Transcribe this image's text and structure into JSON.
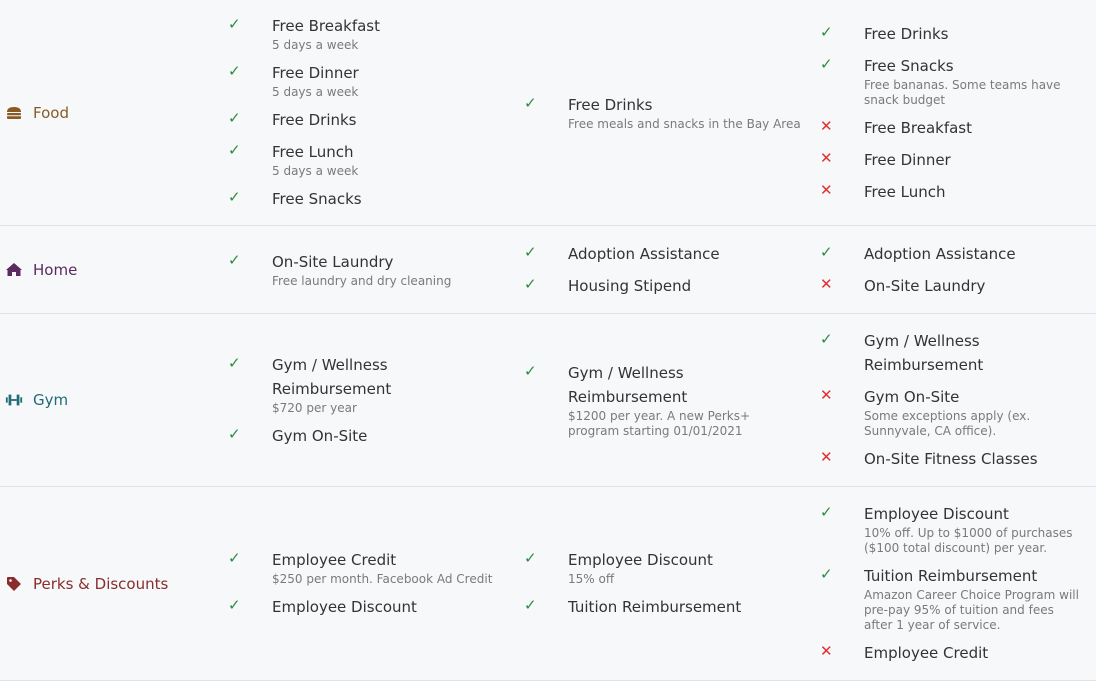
{
  "rows": [
    {
      "category": "Food",
      "icon": "burger-icon",
      "color": "#8a5a24",
      "cols": [
        [
          {
            "ok": true,
            "name": "Free Breakfast",
            "note": "5 days a week"
          },
          {
            "ok": true,
            "name": "Free Dinner",
            "note": "5 days a week"
          },
          {
            "ok": true,
            "name": "Free Drinks",
            "note": ""
          },
          {
            "ok": true,
            "name": "Free Lunch",
            "note": "5 days a week"
          },
          {
            "ok": true,
            "name": "Free Snacks",
            "note": ""
          }
        ],
        [
          {
            "ok": true,
            "name": "Free Drinks",
            "note": "Free meals and snacks in the Bay Area"
          }
        ],
        [
          {
            "ok": true,
            "name": "Free Drinks",
            "note": ""
          },
          {
            "ok": true,
            "name": "Free Snacks",
            "note": "Free bananas. Some teams have snack budget"
          },
          {
            "ok": false,
            "name": "Free Breakfast",
            "note": ""
          },
          {
            "ok": false,
            "name": "Free Dinner",
            "note": ""
          },
          {
            "ok": false,
            "name": "Free Lunch",
            "note": ""
          }
        ]
      ]
    },
    {
      "category": "Home",
      "icon": "house-icon",
      "color": "#5b2a5e",
      "cols": [
        [
          {
            "ok": true,
            "name": "On-Site Laundry",
            "note": "Free laundry and dry cleaning"
          }
        ],
        [
          {
            "ok": true,
            "name": "Adoption Assistance",
            "note": ""
          },
          {
            "ok": true,
            "name": "Housing Stipend",
            "note": ""
          }
        ],
        [
          {
            "ok": true,
            "name": "Adoption Assistance",
            "note": ""
          },
          {
            "ok": false,
            "name": "On-Site Laundry",
            "note": ""
          }
        ]
      ]
    },
    {
      "category": "Gym",
      "icon": "dumbbell-icon",
      "color": "#1f6b73",
      "cols": [
        [
          {
            "ok": true,
            "name": "Gym / Wellness Reimbursement",
            "note": "$720 per year"
          },
          {
            "ok": true,
            "name": "Gym On-Site",
            "note": ""
          }
        ],
        [
          {
            "ok": true,
            "name": "Gym / Wellness Reimbursement",
            "note": "$1200 per year. A new Perks+ program starting 01/01/2021"
          }
        ],
        [
          {
            "ok": true,
            "name": "Gym / Wellness Reimbursement",
            "note": ""
          },
          {
            "ok": false,
            "name": "Gym On-Site",
            "note": "Some exceptions apply (ex. Sunnyvale, CA office)."
          },
          {
            "ok": false,
            "name": "On-Site Fitness Classes",
            "note": ""
          }
        ]
      ]
    },
    {
      "category": "Perks & Discounts",
      "icon": "tag-icon",
      "color": "#8a2c2c",
      "cols": [
        [
          {
            "ok": true,
            "name": "Employee Credit",
            "note": "$250 per month. Facebook Ad Credit"
          },
          {
            "ok": true,
            "name": "Employee Discount",
            "note": ""
          }
        ],
        [
          {
            "ok": true,
            "name": "Employee Discount",
            "note": "15% off"
          },
          {
            "ok": true,
            "name": "Tuition Reimbursement",
            "note": ""
          }
        ],
        [
          {
            "ok": true,
            "name": "Employee Discount",
            "note": "10% off. Up to $1000 of purchases ($100 total discount) per year."
          },
          {
            "ok": true,
            "name": "Tuition Reimbursement",
            "note": "Amazon Career Choice Program will pre-pay 95% of tuition and fees after 1 year of service."
          },
          {
            "ok": false,
            "name": "Employee Credit",
            "note": ""
          }
        ]
      ]
    }
  ],
  "marks": {
    "yes": "✓",
    "no": "✕"
  },
  "colors": {
    "yes": "#2e8b3e",
    "no": "#e03131",
    "background": "#f7f8fa",
    "divider": "#dfe3e8"
  }
}
